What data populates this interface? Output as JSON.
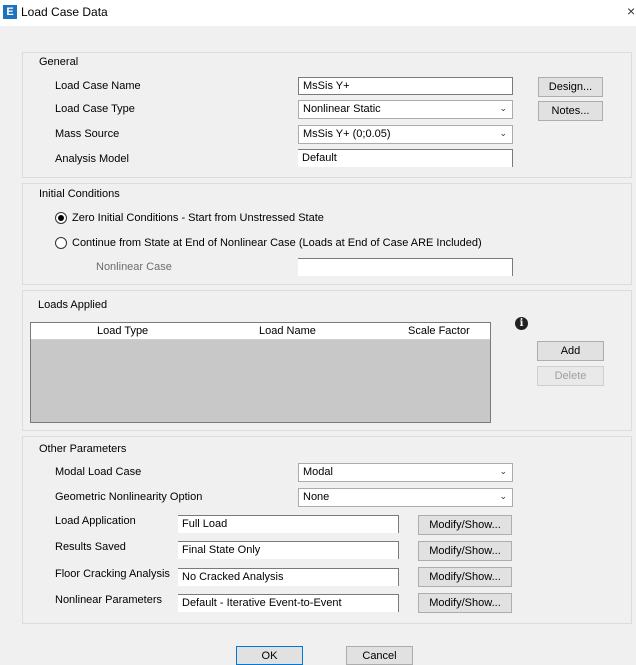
{
  "window": {
    "app_icon": "E",
    "title": "Load Case Data",
    "close_glyph": "×"
  },
  "general": {
    "title": "General",
    "load_case_name_label": "Load Case Name",
    "load_case_name_value": "MsSis Y+",
    "load_case_type_label": "Load Case Type",
    "load_case_type_value": "Nonlinear Static",
    "mass_source_label": "Mass Source",
    "mass_source_value": "MsSis Y+ (0;0.05)",
    "analysis_model_label": "Analysis Model",
    "analysis_model_value": "Default",
    "design_button": "Design...",
    "notes_button": "Notes..."
  },
  "initial_conditions": {
    "title": "Initial Conditions",
    "option_zero": "Zero Initial Conditions - Start from Unstressed State",
    "option_continue": "Continue from State at End of Nonlinear Case  (Loads at End of Case ARE Included)",
    "nonlinear_case_label": "Nonlinear Case",
    "nonlinear_case_value": "",
    "selected": "zero"
  },
  "loads_applied": {
    "title": "Loads Applied",
    "columns": [
      "Load Type",
      "Load Name",
      "Scale Factor"
    ],
    "rows": [],
    "add_button": "Add",
    "delete_button": "Delete",
    "info_icon": "info-icon"
  },
  "other_parameters": {
    "title": "Other Parameters",
    "modal_load_case_label": "Modal Load Case",
    "modal_load_case_value": "Modal",
    "geometric_nonlinearity_label": "Geometric Nonlinearity Option",
    "geometric_nonlinearity_value": "None",
    "load_application_label": "Load Application",
    "load_application_value": "Full Load",
    "results_saved_label": "Results Saved",
    "results_saved_value": "Final State Only",
    "floor_cracking_label": "Floor Cracking Analysis",
    "floor_cracking_value": "No Cracked Analysis",
    "nonlinear_parameters_label": "Nonlinear Parameters",
    "nonlinear_parameters_value": "Default - Iterative Event-to-Event",
    "modify_show_label": "Modify/Show..."
  },
  "footer": {
    "ok_button": "OK",
    "cancel_button": "Cancel"
  },
  "colors": {
    "accent": "#0078d7",
    "app_icon_bg": "#1e73be",
    "grid_bg": "#c8c8c8"
  }
}
